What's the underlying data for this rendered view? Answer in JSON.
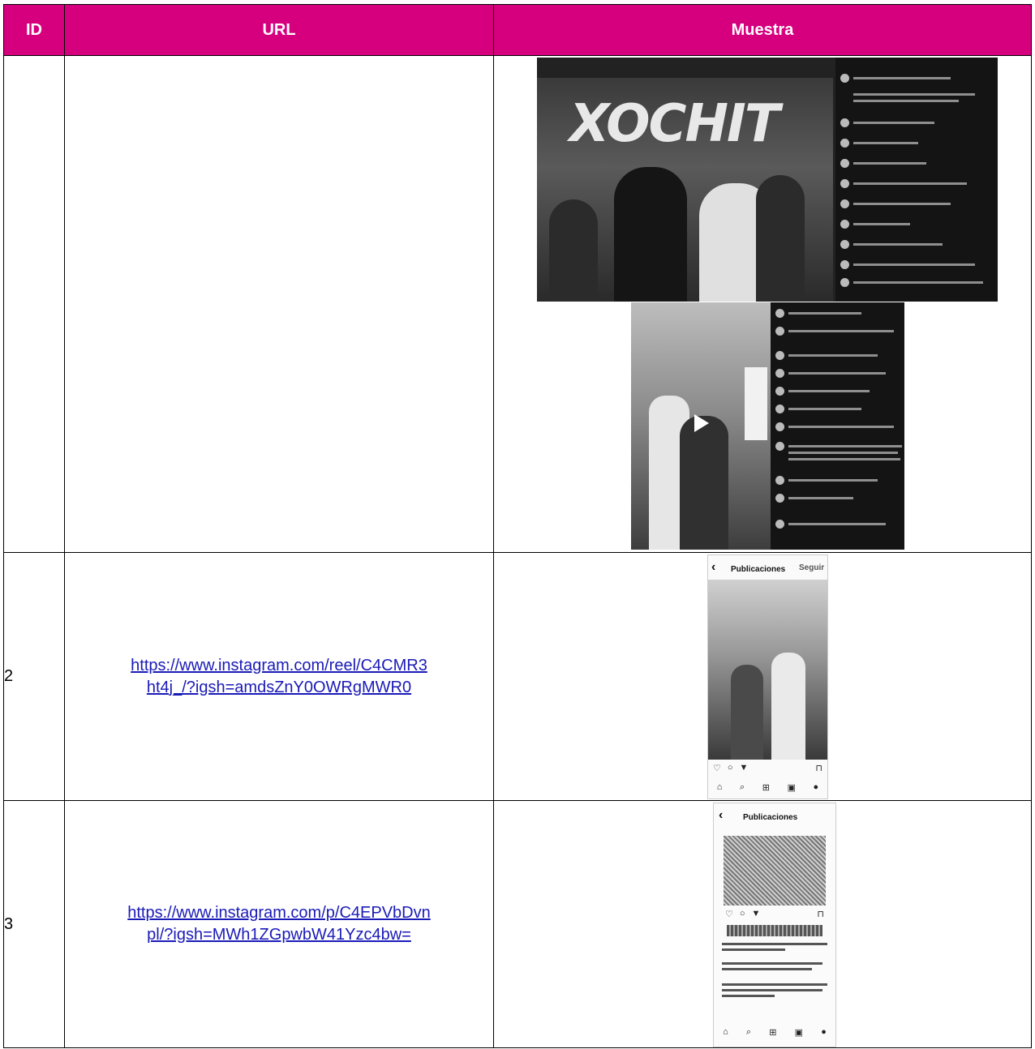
{
  "table": {
    "headers": {
      "id": "ID",
      "url": "URL",
      "sample": "Muestra"
    },
    "rows": [
      {
        "id": "",
        "url": ""
      },
      {
        "id": "2",
        "url": "https://www.instagram.com/reel/C4CMR3ht4j_/?igsh=amdsZnY0OWRgMWR0",
        "url_line1": "https://www.instagram.com/reel/C4CMR3",
        "url_line2": "ht4j_/?igsh=amdsZnY0OWRgMWR0"
      },
      {
        "id": "3",
        "url": "https://www.instagram.com/p/C4EPVbDvnpl/?igsh=MWh1ZGpwbW41Yzc4bw=",
        "url_line1": "https://www.instagram.com/p/C4EPVbDvn",
        "url_line2": "pl/?igsh=MWh1ZGpwbW41Yzc4bw="
      }
    ]
  },
  "samples": {
    "shot1_banner": "XOCHIT",
    "phone2": {
      "follow": "Seguir",
      "back": "‹",
      "title": "Publicaciones"
    },
    "phone3": {
      "back": "‹",
      "title": "Publicaciones"
    }
  },
  "colors": {
    "header_bg": "#d6007e",
    "link": "#1a1ab8"
  }
}
